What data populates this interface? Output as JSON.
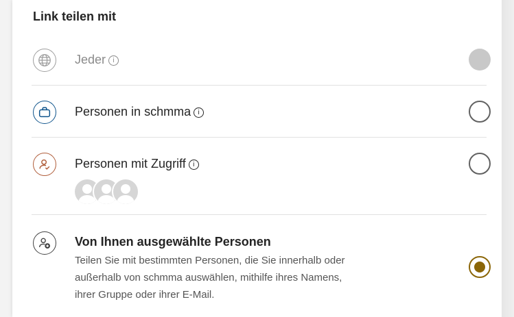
{
  "header": {
    "title": "Link teilen mit"
  },
  "options": [
    {
      "label": "Jeder",
      "info_icon": "info-icon",
      "icon": "globe-icon",
      "state": "disabled"
    },
    {
      "label": "Personen in schmma",
      "info_icon": "info-icon",
      "icon": "briefcase-icon",
      "state": "unselected"
    },
    {
      "label": "Personen mit Zugriff",
      "info_icon": "info-icon",
      "icon": "person-access-icon",
      "state": "unselected",
      "avatars": [
        "avatar",
        "avatar",
        "avatar"
      ]
    },
    {
      "label": "Von Ihnen ausgewählte Personen",
      "icon": "person-add-icon",
      "state": "selected",
      "description_lines": [
        "Teilen Sie mit bestimmten Personen, die Sie innerhalb oder",
        "außerhalb von schmma auswählen, mithilfe ihres Namens,",
        "ihrer Gruppe oder ihrer E-Mail."
      ]
    }
  ],
  "colors": {
    "accent": "#8b6608",
    "briefcase": "#0f548c",
    "person_access": "#b05e3b",
    "disabled": "#c8c8c8"
  }
}
